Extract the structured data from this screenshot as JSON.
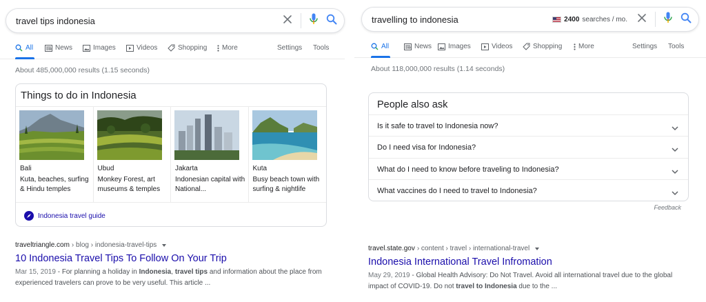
{
  "left": {
    "search": {
      "query": "travel tips indonesia"
    },
    "tabs": {
      "all": "All",
      "news": "News",
      "images": "Images",
      "videos": "Videos",
      "shopping": "Shopping",
      "more": "More",
      "settings": "Settings",
      "tools": "Tools"
    },
    "stats": "About 485,000,000 results (1.15 seconds)",
    "things_to_do": {
      "title": "Things to do in Indonesia",
      "places": [
        {
          "name": "Bali",
          "desc": "Kuta, beaches, surfing & Hindu temples"
        },
        {
          "name": "Ubud",
          "desc": "Monkey Forest, art museums & temples"
        },
        {
          "name": "Jakarta",
          "desc": "Indonesian capital with National..."
        },
        {
          "name": "Kuta",
          "desc": "Busy beach town with surfing & nightlife"
        }
      ],
      "guide_link": "Indonesia travel guide"
    },
    "result": {
      "site": "traveltriangle.com",
      "path": "› blog › indonesia-travel-tips",
      "title": "10 Indonesia Travel Tips To Follow On Your Trip",
      "date": "Mar 15, 2019",
      "snippet_parts": [
        {
          "t": " - For planning a holiday in ",
          "b": false
        },
        {
          "t": "Indonesia",
          "b": true
        },
        {
          "t": ", ",
          "b": false
        },
        {
          "t": "travel tips",
          "b": true
        },
        {
          "t": " and information about the place from experienced travelers can prove to be very useful. This article ...",
          "b": false
        }
      ]
    }
  },
  "right": {
    "search": {
      "query": "travelling to indonesia",
      "volume": "2400",
      "volume_suffix": "searches / mo."
    },
    "tabs": {
      "all": "All",
      "news": "News",
      "images": "Images",
      "videos": "Videos",
      "shopping": "Shopping",
      "more": "More",
      "settings": "Settings",
      "tools": "Tools"
    },
    "stats": "About 118,000,000 results (1.14 seconds)",
    "paa": {
      "title": "People also ask",
      "questions": [
        "Is it safe to travel to Indonesia now?",
        "Do I need visa for Indonesia?",
        "What do I need to know before traveling to Indonesia?",
        "What vaccines do I need to travel to Indonesia?"
      ],
      "feedback": "Feedback"
    },
    "result": {
      "site": "travel.state.gov",
      "path": "› content › travel › international-travel",
      "title": "Indonesia International Travel Infromation",
      "date": "May 29, 2019",
      "snippet_parts": [
        {
          "t": " - Global Health Advisory: Do Not Travel. Avoid all international travel due to the global impact of COVID-19. Do not ",
          "b": false
        },
        {
          "t": "travel to Indonesia",
          "b": true
        },
        {
          "t": " due to the ...",
          "b": false
        }
      ]
    }
  },
  "colors": {
    "link": "#1a0dab",
    "accent": "#1a73e8",
    "text": "#202124",
    "muted": "#70757a"
  },
  "icons": [
    "search-icon",
    "clear-icon",
    "mic-icon",
    "news-icon",
    "images-icon",
    "videos-icon",
    "shopping-tag-icon",
    "more-dots-icon",
    "compass-icon",
    "chevron-down-icon",
    "us-flag-icon"
  ]
}
